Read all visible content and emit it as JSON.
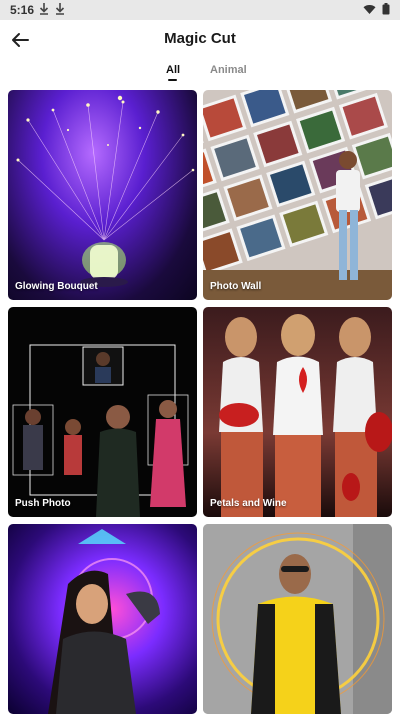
{
  "status": {
    "time": "5:16"
  },
  "header": {
    "title": "Magic Cut"
  },
  "tabs": [
    {
      "label": "All",
      "selected": true
    },
    {
      "label": "Animal",
      "selected": false
    }
  ],
  "cards": [
    {
      "label": "Glowing Bouquet"
    },
    {
      "label": "Photo Wall"
    },
    {
      "label": "Push Photo"
    },
    {
      "label": "Petals and Wine"
    },
    {
      "label": ""
    },
    {
      "label": ""
    }
  ]
}
